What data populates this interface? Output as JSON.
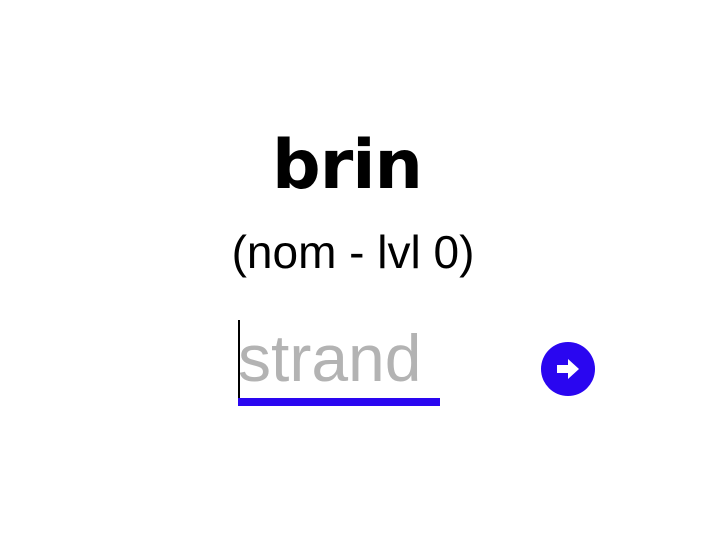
{
  "card": {
    "word": "brin",
    "info": "(nom - lvl 0)"
  },
  "answer": {
    "value": "",
    "placeholder": "strand"
  },
  "submit": {
    "icon": "arrow-right-circle-icon",
    "color": "#2a06f0"
  },
  "colors": {
    "accent": "#2a06f0",
    "placeholder": "#b3b3b3",
    "text": "#000000"
  }
}
